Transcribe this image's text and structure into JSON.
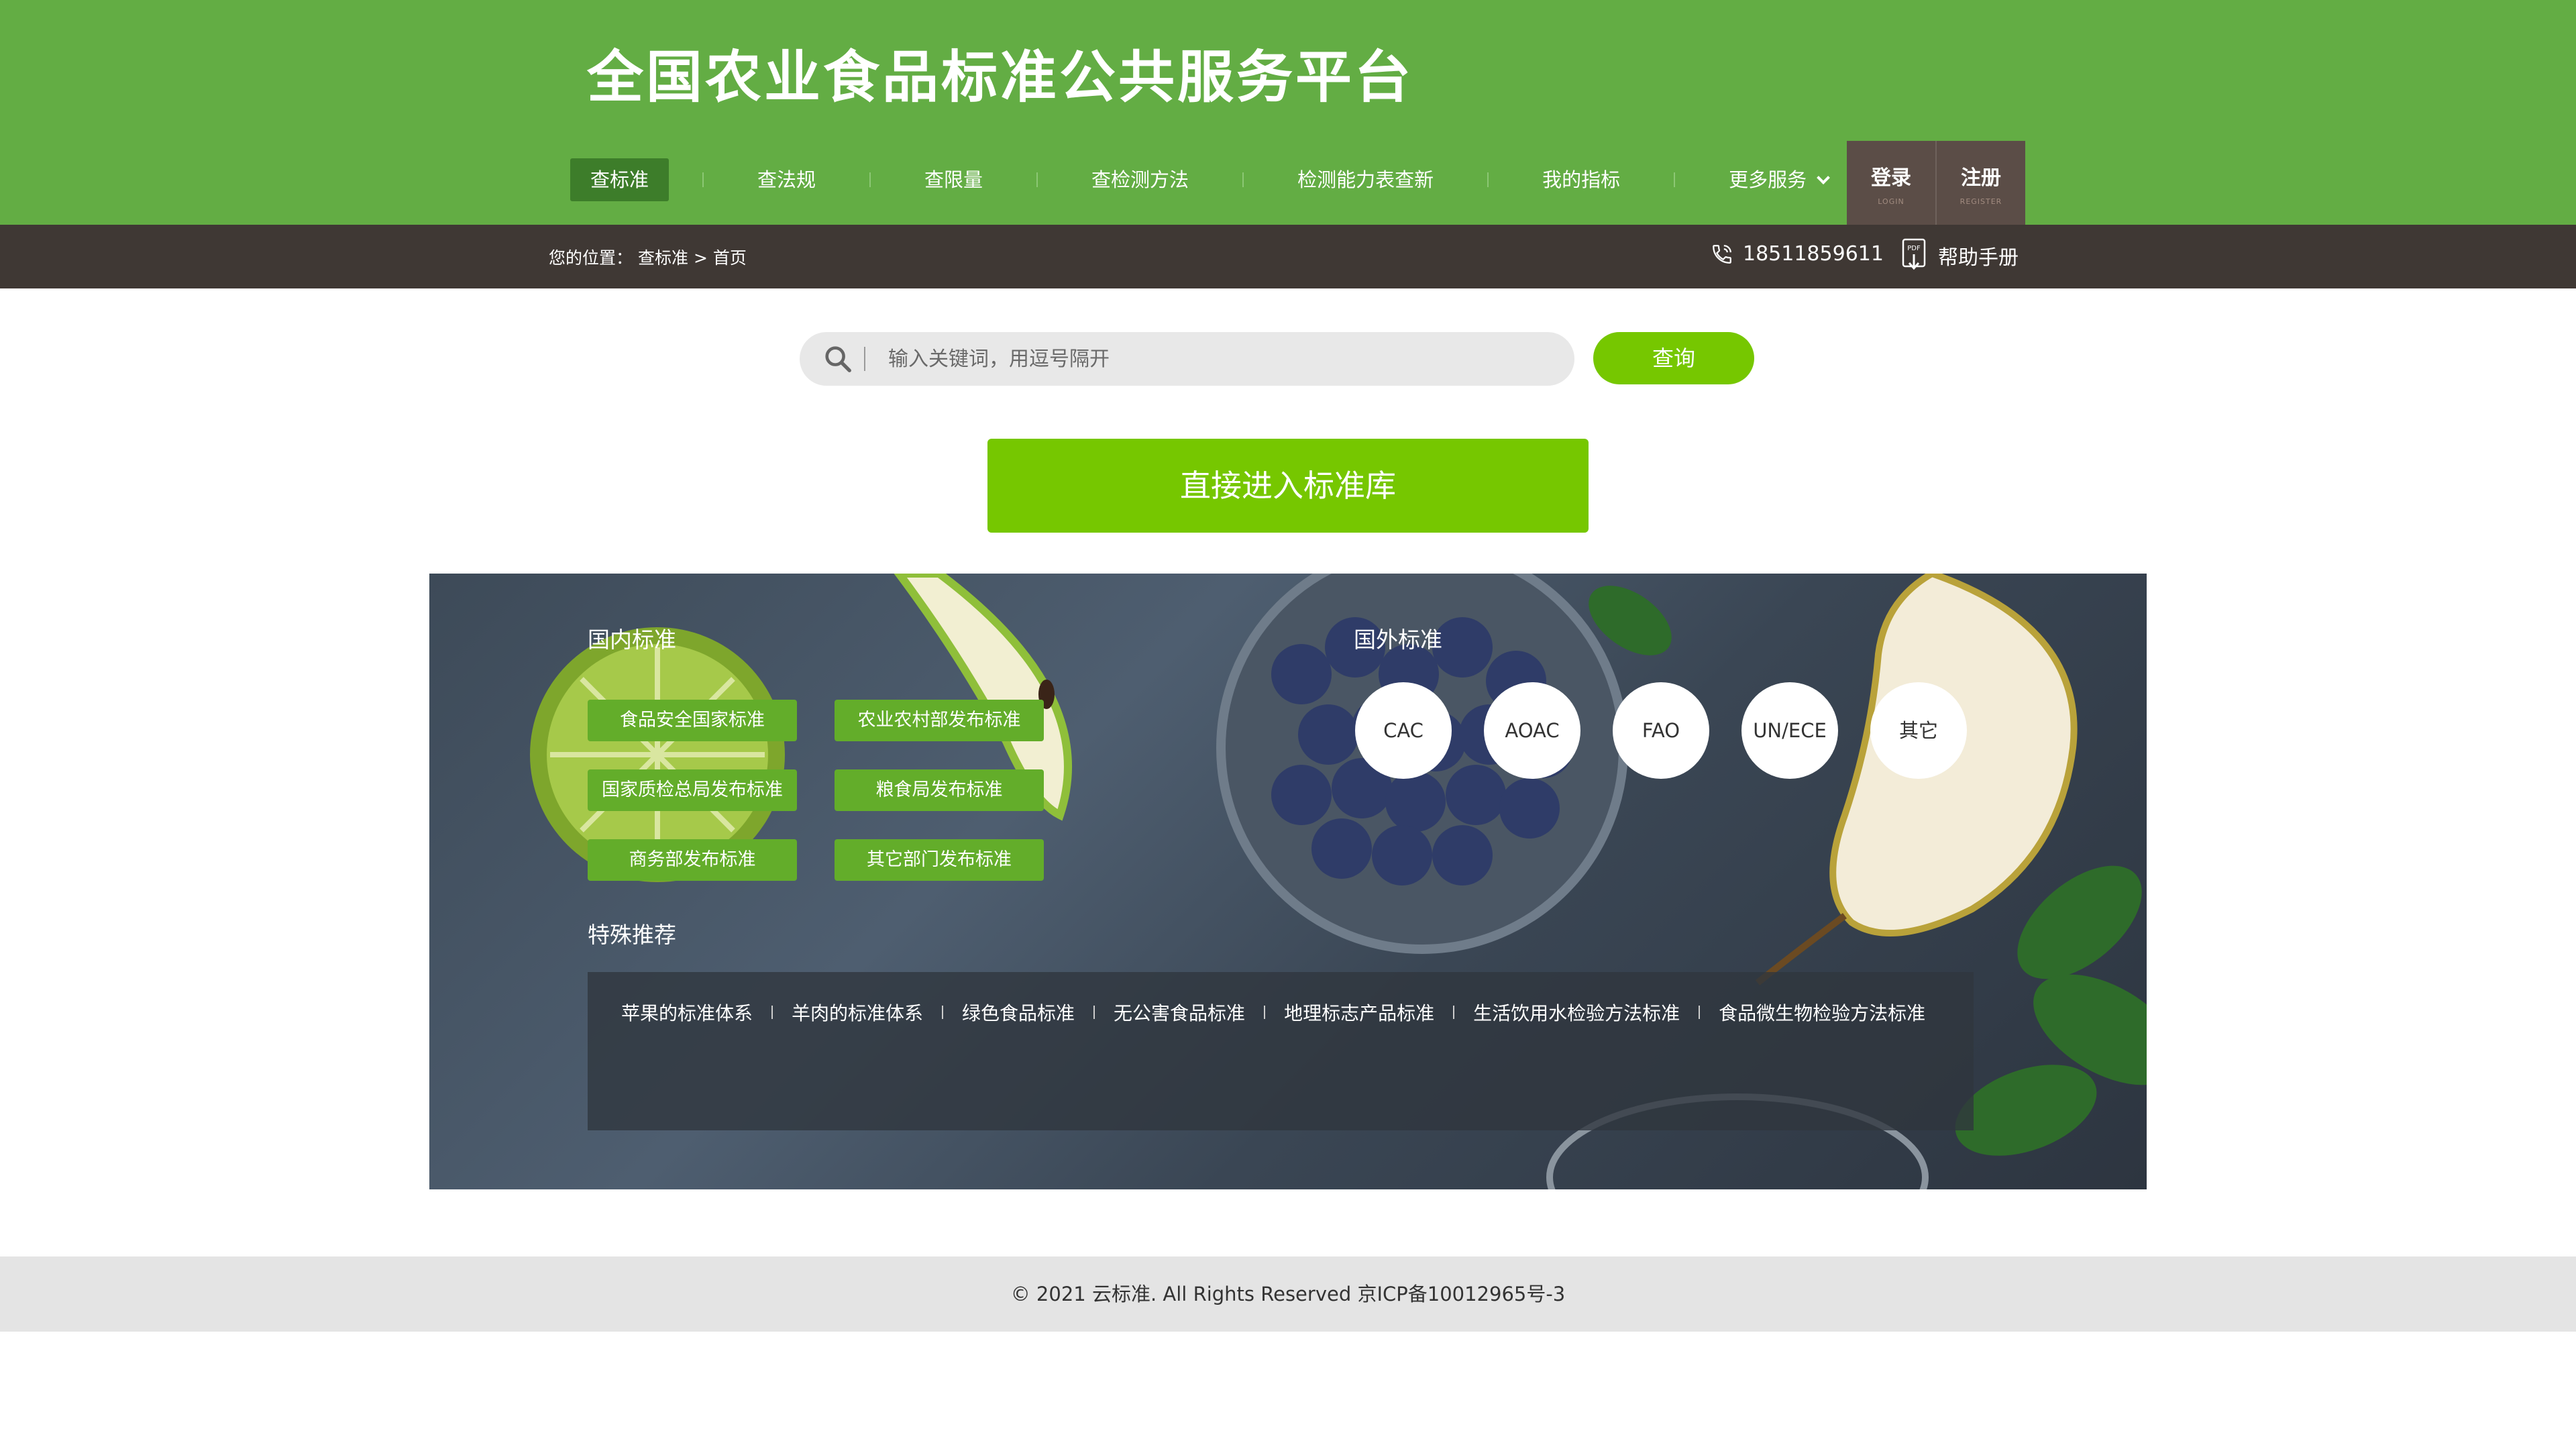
{
  "header": {
    "title": "全国农业食品标准公共服务平台",
    "nav": [
      {
        "label": "查标准"
      },
      {
        "label": "查法规"
      },
      {
        "label": "查限量"
      },
      {
        "label": "查检测方法"
      },
      {
        "label": "检测能力表查新"
      },
      {
        "label": "我的指标"
      },
      {
        "label": "更多服务"
      }
    ],
    "login": {
      "label": "登录",
      "sub": "LOGIN"
    },
    "register": {
      "label": "注册",
      "sub": "REGISTER"
    }
  },
  "breadcrumb": {
    "prefix": "您的位置：",
    "path": [
      "查标准",
      "首页"
    ],
    "separator": ">"
  },
  "contact": {
    "phone": "18511859611",
    "help": "帮助手册",
    "pdf_badge": "PDF"
  },
  "search": {
    "placeholder": "输入关键词，用逗号隔开",
    "button": "查询"
  },
  "enter_library": "直接进入标准库",
  "domestic": {
    "title": "国内标准",
    "items": [
      "食品安全国家标准",
      "农业农村部发布标准",
      "国家质检总局发布标准",
      "粮食局发布标准",
      "商务部发布标准",
      "其它部门发布标准"
    ]
  },
  "foreign": {
    "title": "国外标准",
    "items": [
      "CAC",
      "AOAC",
      "FAO",
      "UN/ECE",
      "其它"
    ]
  },
  "special": {
    "title": "特殊推荐",
    "items": [
      "苹果的标准体系",
      "羊肉的标准体系",
      "绿色食品标准",
      "无公害食品标准",
      "地理标志产品标准",
      "生活饮用水检验方法标准",
      "食品微生物检验方法标准"
    ]
  },
  "footer": "© 2021 云标准. All Rights Reserved 京ICP备10012965号-3",
  "colors": {
    "header_green": "#63ad44",
    "dark_bar": "#3f3834",
    "button_green": "#76c700",
    "tag_green": "#63ad2a",
    "auth_bg": "#5b4d47"
  }
}
